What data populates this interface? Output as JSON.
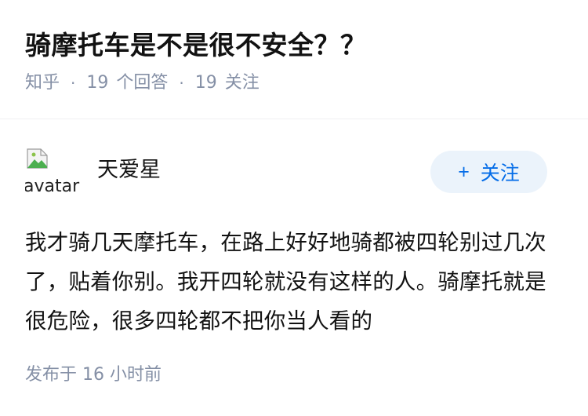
{
  "question": {
    "title": "骑摩托车是不是很不安全？？"
  },
  "meta": {
    "source": "知乎",
    "separator": "·",
    "answers_count": "19",
    "answers_label": "个回答",
    "followers_count": "19",
    "followers_label": "关注"
  },
  "answer": {
    "avatar_alt": "avatar",
    "author_name": "天爱星",
    "follow_plus": "+",
    "follow_label": "关注",
    "content": "我才骑几天摩托车，在路上好好地骑都被四轮别过几次了，贴着你别。我开四轮就没有这样的人。骑摩托就是很危险，很多四轮都不把你当人看的",
    "published_label": "发布于",
    "published_time": "16 小时前"
  },
  "colors": {
    "title": "#121212",
    "meta": "#8590a6",
    "follow_bg": "#ebf3fb",
    "follow_text": "#056de8"
  }
}
